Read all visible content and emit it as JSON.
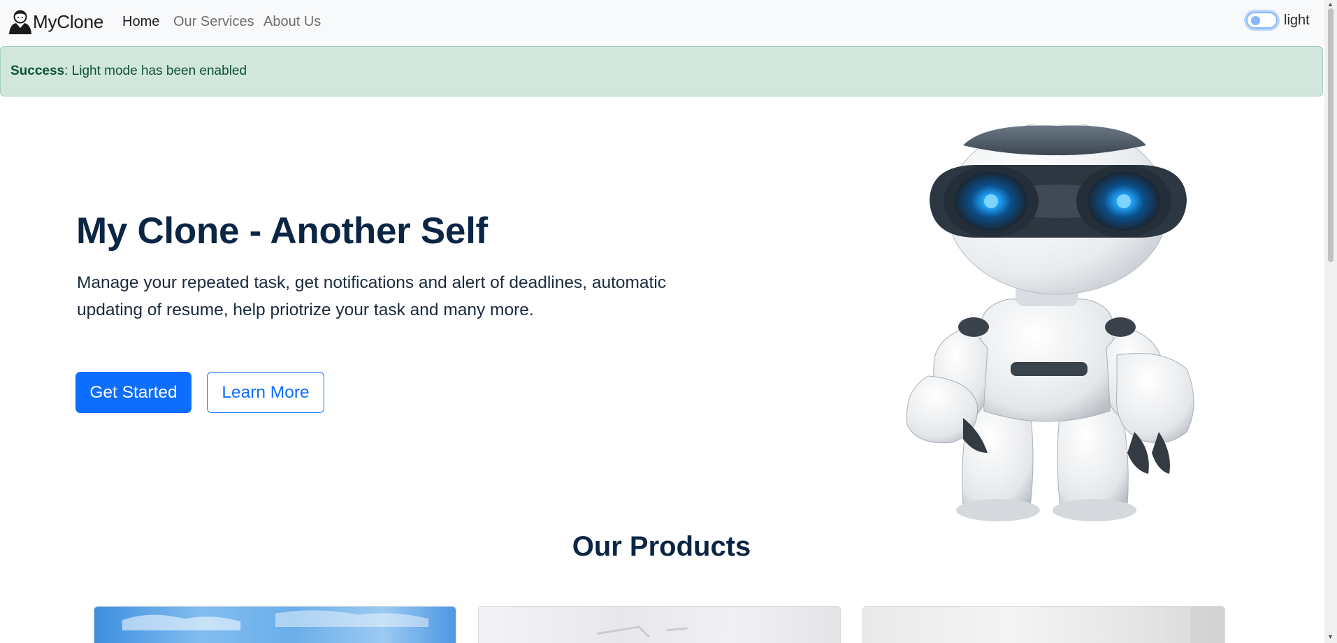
{
  "navbar": {
    "brand": "MyClone",
    "links": [
      {
        "label": "Home",
        "active": true
      },
      {
        "label": "Our Services",
        "active": false
      },
      {
        "label": "About Us",
        "active": false
      }
    ],
    "theme_toggle": {
      "label": "light",
      "checked": false
    }
  },
  "alert": {
    "strong": "Success",
    "message": ": Light mode has been enabled"
  },
  "hero": {
    "title": "My Clone - Another Self",
    "text": "Manage your repeated task, get notifications and alert of deadlines, automatic updating of resume, help priotrize your task and many more.",
    "primary_button": "Get Started",
    "secondary_button": "Learn More",
    "image": "robot-illustration"
  },
  "products": {
    "title": "Our Products",
    "cards": [
      "product-image-sky",
      "product-image-white",
      "product-image-gray"
    ]
  },
  "colors": {
    "primary": "#0d6efd",
    "heading": "#0b2545",
    "alert_bg": "#d1e7dd",
    "alert_text": "#0f5132",
    "navbar_bg": "#f8f9fa"
  }
}
